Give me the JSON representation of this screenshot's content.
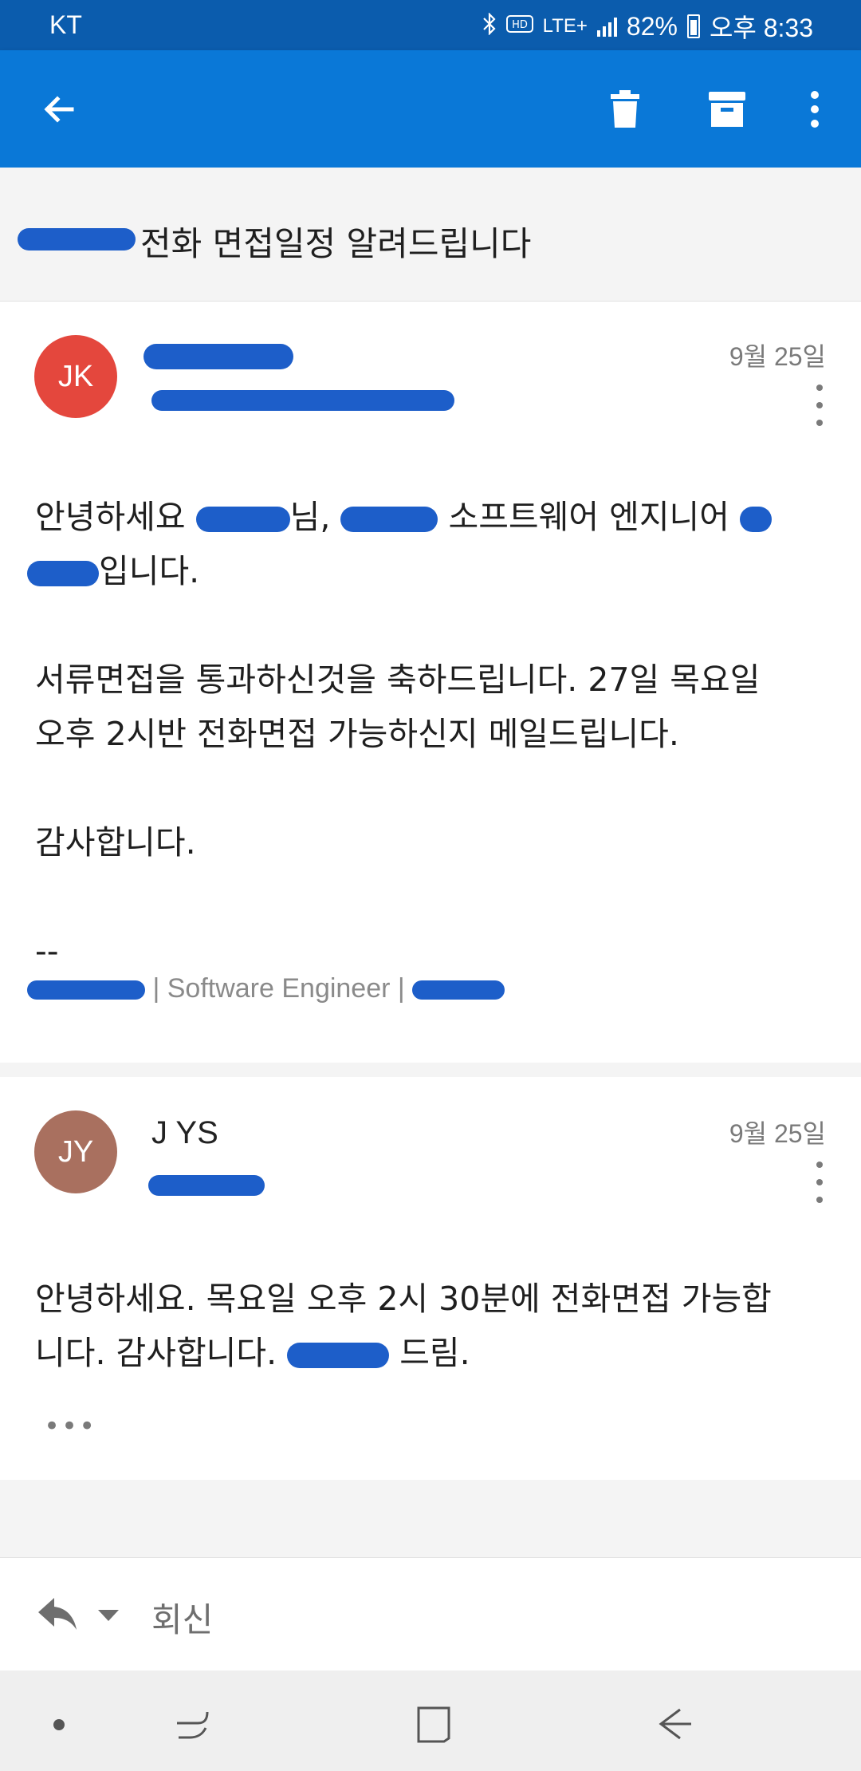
{
  "status_bar": {
    "carrier": "KT",
    "network": "LTE+",
    "battery": "82%",
    "time": "오후 8:33"
  },
  "toolbar": {
    "back_icon": "arrow-left-icon",
    "delete_icon": "trash-icon",
    "archive_icon": "archive-icon",
    "more_icon": "more-vert-icon"
  },
  "subject": "전화 면접일정 알려드립니다",
  "messages": [
    {
      "avatar_initials": "JK",
      "avatar_color": "#e4473d",
      "date": "9월 25일",
      "body": {
        "greeting_prefix": "안녕하세요 ",
        "greeting_mid": "님, ",
        "greeting_tail": " 소프트웨어 엔지니어 ",
        "greeting_end": "입니다.",
        "para2_line1": "서류면접을 통과하신것을 축하드립니다. 27일 목요일",
        "para2_line2": "오후 2시반 전화면접 가능하신지 메일드립니다.",
        "para3": "감사합니다.",
        "sig_dash": "--",
        "signature_mid": "| Software Engineer |"
      }
    },
    {
      "avatar_initials": "JY",
      "avatar_color": "#a9705f",
      "sender": "J YS",
      "date": "9월 25일",
      "body": {
        "line1": "안녕하세요. 목요일 오후 2시 30분에 전화면접 가능합",
        "line2_prefix": "니다. 감사합니다. ",
        "line2_suffix": " 드림."
      },
      "ellipsis": "•••"
    }
  ],
  "reply": {
    "label": "회신",
    "icon": "reply-icon",
    "dropdown_icon": "caret-down-icon"
  },
  "nav": {
    "dot_icon": "dot-icon",
    "recents_icon": "recents-icon",
    "home_icon": "home-icon",
    "back_icon": "nav-back-icon"
  },
  "colors": {
    "status_bar": "#0b5cad",
    "app_bar": "#0a78d7",
    "redaction": "#1d5ec9"
  }
}
